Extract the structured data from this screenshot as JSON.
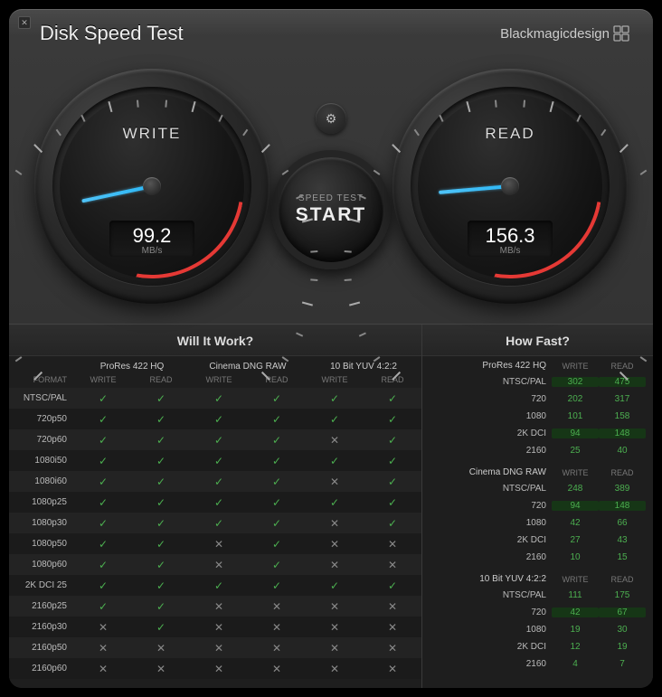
{
  "title": "Disk Speed Test",
  "brand": "Blackmagicdesign",
  "gauges": {
    "write": {
      "label": "WRITE",
      "value": "99.2",
      "unit": "MB/s",
      "needle_deg": -102
    },
    "read": {
      "label": "READ",
      "value": "156.3",
      "unit": "MB/s",
      "needle_deg": -95
    }
  },
  "start_btn": {
    "top": "SPEED TEST",
    "main": "START"
  },
  "will_it_work": {
    "title": "Will It Work?",
    "codecs": [
      "ProRes 422 HQ",
      "Cinema DNG RAW",
      "10 Bit YUV 4:2:2"
    ],
    "sub": [
      "WRITE",
      "READ",
      "WRITE",
      "READ",
      "WRITE",
      "READ"
    ],
    "format_label": "FORMAT",
    "rows": [
      {
        "fmt": "NTSC/PAL",
        "cells": [
          1,
          1,
          1,
          1,
          1,
          1
        ]
      },
      {
        "fmt": "720p50",
        "cells": [
          1,
          1,
          1,
          1,
          1,
          1
        ]
      },
      {
        "fmt": "720p60",
        "cells": [
          1,
          1,
          1,
          1,
          0,
          1
        ]
      },
      {
        "fmt": "1080i50",
        "cells": [
          1,
          1,
          1,
          1,
          1,
          1
        ]
      },
      {
        "fmt": "1080i60",
        "cells": [
          1,
          1,
          1,
          1,
          0,
          1
        ]
      },
      {
        "fmt": "1080p25",
        "cells": [
          1,
          1,
          1,
          1,
          1,
          1
        ]
      },
      {
        "fmt": "1080p30",
        "cells": [
          1,
          1,
          1,
          1,
          0,
          1
        ]
      },
      {
        "fmt": "1080p50",
        "cells": [
          1,
          1,
          0,
          1,
          0,
          0
        ]
      },
      {
        "fmt": "1080p60",
        "cells": [
          1,
          1,
          0,
          1,
          0,
          0
        ]
      },
      {
        "fmt": "2K DCI 25",
        "cells": [
          1,
          1,
          1,
          1,
          1,
          1
        ]
      },
      {
        "fmt": "2160p25",
        "cells": [
          1,
          1,
          0,
          0,
          0,
          0
        ]
      },
      {
        "fmt": "2160p30",
        "cells": [
          0,
          1,
          0,
          0,
          0,
          0
        ]
      },
      {
        "fmt": "2160p50",
        "cells": [
          0,
          0,
          0,
          0,
          0,
          0
        ]
      },
      {
        "fmt": "2160p60",
        "cells": [
          0,
          0,
          0,
          0,
          0,
          0
        ]
      }
    ]
  },
  "how_fast": {
    "title": "How Fast?",
    "sub": [
      "WRITE",
      "READ"
    ],
    "groups": [
      {
        "name": "ProRes 422 HQ",
        "rows": [
          {
            "res": "NTSC/PAL",
            "w": "302",
            "r": "475",
            "bg": 1
          },
          {
            "res": "720",
            "w": "202",
            "r": "317"
          },
          {
            "res": "1080",
            "w": "101",
            "r": "158"
          },
          {
            "res": "2K DCI",
            "w": "94",
            "r": "148",
            "bg": 1
          },
          {
            "res": "2160",
            "w": "25",
            "r": "40"
          }
        ]
      },
      {
        "name": "Cinema DNG RAW",
        "rows": [
          {
            "res": "NTSC/PAL",
            "w": "248",
            "r": "389"
          },
          {
            "res": "720",
            "w": "94",
            "r": "148",
            "bg": 1
          },
          {
            "res": "1080",
            "w": "42",
            "r": "66"
          },
          {
            "res": "2K DCI",
            "w": "27",
            "r": "43"
          },
          {
            "res": "2160",
            "w": "10",
            "r": "15"
          }
        ]
      },
      {
        "name": "10 Bit YUV 4:2:2",
        "rows": [
          {
            "res": "NTSC/PAL",
            "w": "111",
            "r": "175"
          },
          {
            "res": "720",
            "w": "42",
            "r": "67",
            "bg": 1
          },
          {
            "res": "1080",
            "w": "19",
            "r": "30"
          },
          {
            "res": "2K DCI",
            "w": "12",
            "r": "19"
          },
          {
            "res": "2160",
            "w": "4",
            "r": "7"
          }
        ]
      }
    ]
  }
}
